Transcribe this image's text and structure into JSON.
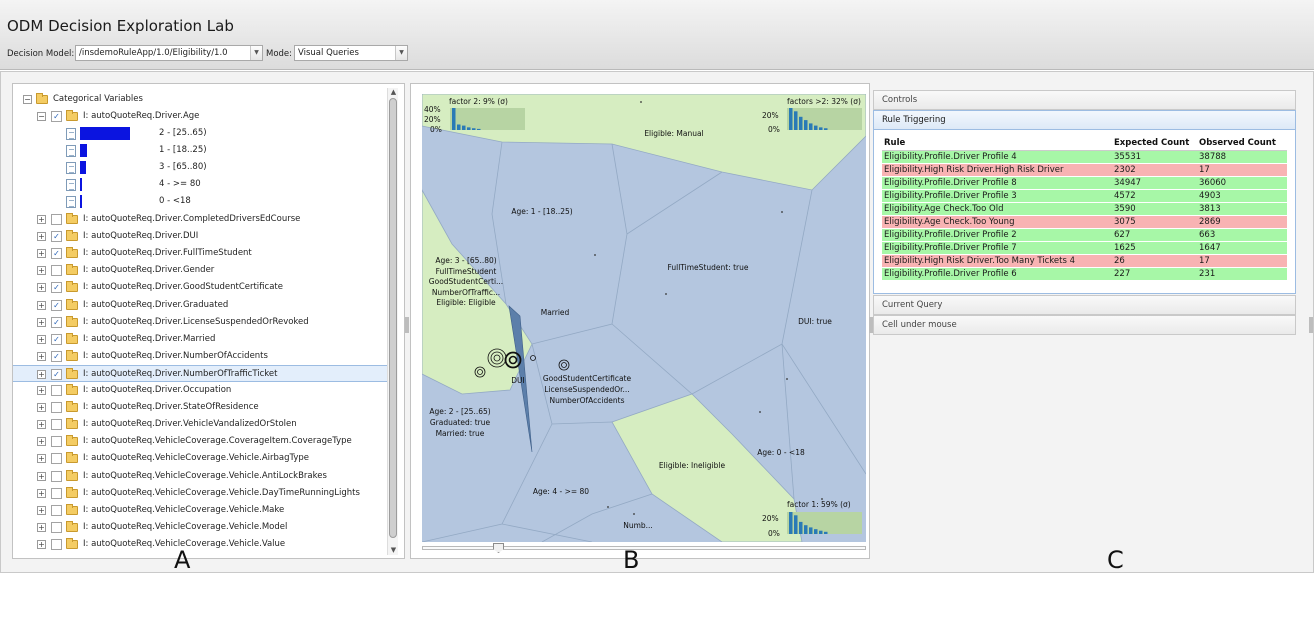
{
  "app": {
    "title": "ODM Decision Exploration Lab",
    "decision_model_label": "Decision Model:",
    "decision_model_value": "/insdemoRuleApp/1.0/Eligibility/1.0",
    "mode_label": "Mode:",
    "mode_value": "Visual Queries"
  },
  "tree": {
    "root_label": "Categorical Variables",
    "age_node_label": "I: autoQuoteReq.Driver.Age",
    "age_bins": [
      {
        "label": "2 - [25..65)",
        "fraction": 1.0
      },
      {
        "label": "1 - [18..25)",
        "fraction": 0.13
      },
      {
        "label": "3 - [65..80)",
        "fraction": 0.11
      },
      {
        "label": "4 - >= 80",
        "fraction": 0.03
      },
      {
        "label": "0 - <18",
        "fraction": 0.03
      }
    ],
    "items": [
      {
        "label": "I: autoQuoteReq.Driver.CompletedDriversEdCourse",
        "checked": false
      },
      {
        "label": "I: autoQuoteReq.Driver.DUI",
        "checked": true
      },
      {
        "label": "I: autoQuoteReq.Driver.FullTimeStudent",
        "checked": true
      },
      {
        "label": "I: autoQuoteReq.Driver.Gender",
        "checked": false
      },
      {
        "label": "I: autoQuoteReq.Driver.GoodStudentCertificate",
        "checked": true
      },
      {
        "label": "I: autoQuoteReq.Driver.Graduated",
        "checked": true
      },
      {
        "label": "I: autoQuoteReq.Driver.LicenseSuspendedOrRevoked",
        "checked": true
      },
      {
        "label": "I: autoQuoteReq.Driver.Married",
        "checked": true
      },
      {
        "label": "I: autoQuoteReq.Driver.NumberOfAccidents",
        "checked": true
      },
      {
        "label": "I: autoQuoteReq.Driver.NumberOfTrafficTicket",
        "checked": true
      },
      {
        "label": "I: autoQuoteReq.Driver.Occupation",
        "checked": false
      },
      {
        "label": "I: autoQuoteReq.Driver.StateOfResidence",
        "checked": false
      },
      {
        "label": "I: autoQuoteReq.Driver.VehicleVandalizedOrStolen",
        "checked": false
      },
      {
        "label": "I: autoQuoteReq.VehicleCoverage.CoverageItem.CoverageType",
        "checked": false
      },
      {
        "label": "I: autoQuoteReq.VehicleCoverage.Vehicle.AirbagType",
        "checked": false
      },
      {
        "label": "I: autoQuoteReq.VehicleCoverage.Vehicle.AntiLockBrakes",
        "checked": false
      },
      {
        "label": "I: autoQuoteReq.VehicleCoverage.Vehicle.DayTimeRunningLights",
        "checked": false
      },
      {
        "label": "I: autoQuoteReq.VehicleCoverage.Vehicle.Make",
        "checked": false
      },
      {
        "label": "I: autoQuoteReq.VehicleCoverage.Vehicle.Model",
        "checked": false
      },
      {
        "label": "I: autoQuoteReq.VehicleCoverage.Vehicle.Value",
        "checked": false
      }
    ],
    "selected_label": "I: autoQuoteReq.Driver.NumberOfTrafficTicket"
  },
  "viz": {
    "colors": {
      "blue_region": "#b4c6df",
      "green_region": "#d6edc1",
      "dui_wedge": "#5c7faa",
      "histogram": "#2a7ab6"
    },
    "labels": {
      "eligible_manual": "Eligible: Manual",
      "age1": "Age: 1 - [18..25)",
      "fulltimestudent": "FullTimeStudent: true",
      "dui_true": "DUI: true",
      "married": "Married",
      "dui": "DUI",
      "age3_l1": "Age: 3 - [65..80)",
      "age3_l2": "FullTimeStudent",
      "age3_l3": "GoodStudentCerti...",
      "age3_l4": "NumberOfTraffic...",
      "age3_l5": "Eligible: Eligible",
      "good_l1": "GoodStudentCertificate",
      "good_l2": "LicenseSuspendedOr...",
      "good_l3": "NumberOfAccidents",
      "age2_l1": "Age: 2 - [25..65)",
      "age2_l2": "Graduated: true",
      "age2_l3": "Married: true",
      "ineligible": "Eligible: Ineligible",
      "age0": "Age: 0 - <18",
      "age4": "Age: 4 - >= 80",
      "numb": "Numb..."
    },
    "factor_top_left": {
      "title": "factor 2: 9% (σ)",
      "ticks": [
        "40%",
        "20%",
        "0%"
      ]
    },
    "factor_top_right": {
      "title": "factors >2: 32% (σ)",
      "ticks": [
        "20%",
        "0%"
      ]
    },
    "factor_bottom_right": {
      "title": "factor 1: 59% (σ)",
      "ticks": [
        "20%",
        "0%"
      ]
    }
  },
  "controls": {
    "controls_label": "Controls",
    "rule_triggering_label": "Rule Triggering",
    "current_query_label": "Current Query",
    "cell_under_mouse_label": "Cell under mouse"
  },
  "rule_table": {
    "headers": [
      "Rule",
      "Expected Count",
      "Observed Count"
    ],
    "rows": [
      {
        "rule": "Eligibility.Profile.Driver Profile 4",
        "expected": "35531",
        "observed": "38788",
        "status": "ok"
      },
      {
        "rule": "Eligibility.High Risk Driver.High Risk Driver",
        "expected": "2302",
        "observed": "17",
        "status": "bad"
      },
      {
        "rule": "Eligibility.Profile.Driver Profile 8",
        "expected": "34947",
        "observed": "36060",
        "status": "ok"
      },
      {
        "rule": "Eligibility.Profile.Driver Profile 3",
        "expected": "4572",
        "observed": "4903",
        "status": "ok"
      },
      {
        "rule": "Eligibility.Age Check.Too Old",
        "expected": "3590",
        "observed": "3813",
        "status": "ok"
      },
      {
        "rule": "Eligibility.Age Check.Too Young",
        "expected": "3075",
        "observed": "2869",
        "status": "bad"
      },
      {
        "rule": "Eligibility.Profile.Driver Profile 2",
        "expected": "627",
        "observed": "663",
        "status": "ok"
      },
      {
        "rule": "Eligibility.Profile.Driver Profile 7",
        "expected": "1625",
        "observed": "1647",
        "status": "ok"
      },
      {
        "rule": "Eligibility.High Risk Driver.Too Many Tickets 4",
        "expected": "26",
        "observed": "17",
        "status": "bad"
      },
      {
        "rule": "Eligibility.Profile.Driver Profile 6",
        "expected": "227",
        "observed": "231",
        "status": "ok"
      }
    ]
  },
  "figure_labels": {
    "a": "A",
    "b": "B",
    "c": "C"
  }
}
